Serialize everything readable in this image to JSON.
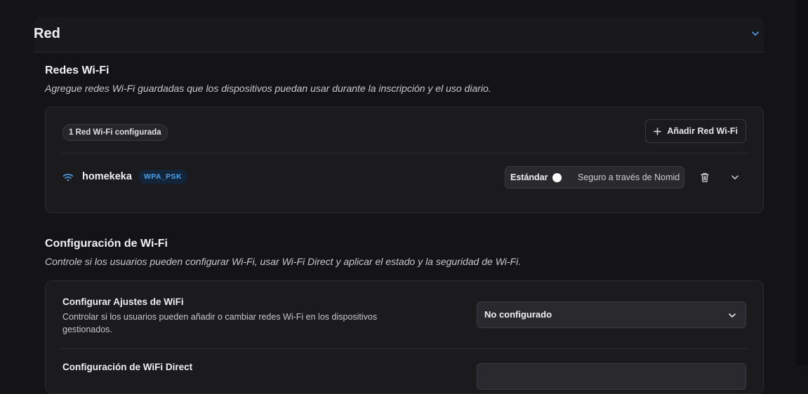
{
  "section": {
    "title": "Red"
  },
  "wifi_networks": {
    "title": "Redes Wi-Fi",
    "description": "Agregue redes Wi-Fi guardadas que los dispositivos puedan usar durante la inscripción y el uso diario.",
    "count_label": "1 Red Wi-Fi configurada",
    "add_button_label": "Añadir Red Wi-Fi",
    "networks": [
      {
        "name": "homekeka",
        "security": "WPA_PSK",
        "mode_left": "Estándar",
        "mode_right": "Seguro a través de Nomid"
      }
    ]
  },
  "wifi_config": {
    "title": "Configuración de Wi-Fi",
    "description": "Controle si los usuarios pueden configurar Wi-Fi, usar Wi-Fi Direct y aplicar el estado y la seguridad de Wi-Fi.",
    "settings": [
      {
        "title": "Configurar Ajustes de WiFi",
        "description": "Controlar si los usuarios pueden añadir o cambiar redes Wi-Fi en los dispositivos gestionados.",
        "value": "No configurado"
      },
      {
        "title": "Configuración de WiFi Direct"
      }
    ]
  },
  "colors": {
    "accent": "#4f9fe6",
    "background": "#141416",
    "card": "#1b1b1e"
  }
}
